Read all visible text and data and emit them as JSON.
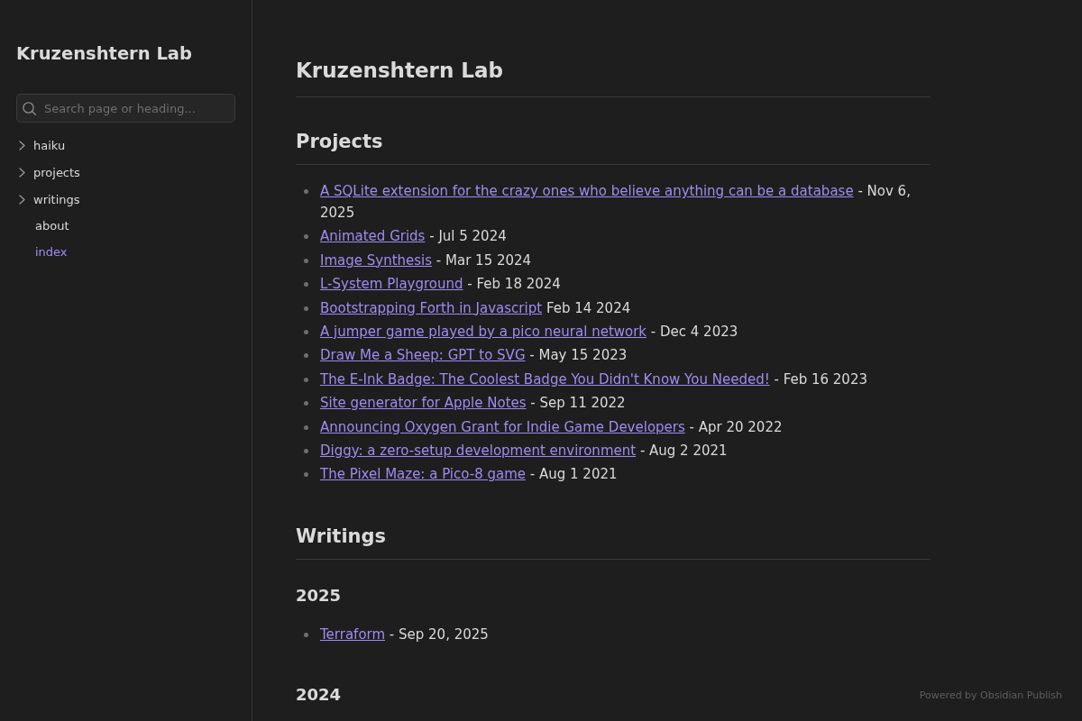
{
  "sidebar": {
    "title": "Kruzenshtern Lab",
    "search": {
      "placeholder": "Search page or heading..."
    },
    "items": [
      {
        "label": "haiku",
        "kind": "folder",
        "expanded": false,
        "selected": false
      },
      {
        "label": "projects",
        "kind": "folder",
        "expanded": false,
        "selected": false
      },
      {
        "label": "writings",
        "kind": "folder",
        "expanded": false,
        "selected": false
      },
      {
        "label": "about",
        "kind": "file",
        "selected": false
      },
      {
        "label": "index",
        "kind": "file",
        "selected": true
      }
    ]
  },
  "page": {
    "title": "Kruzenshtern Lab",
    "sections": [
      {
        "heading": "Projects",
        "entries": [
          {
            "link": "A SQLite extension for the crazy ones who believe anything can be a database",
            "date": "- Nov 6, 2025"
          },
          {
            "link": "Animated Grids",
            "date": "- Jul 5 2024"
          },
          {
            "link": "Image Synthesis",
            "date": "- Mar 15 2024"
          },
          {
            "link": "L-System Playground",
            "date": "- Feb 18 2024"
          },
          {
            "link": "Bootstrapping Forth in Javascript",
            "date": "Feb 14 2024"
          },
          {
            "link": "A jumper game played by a pico neural network",
            "date": "- Dec 4 2023"
          },
          {
            "link": "Draw Me a Sheep: GPT to SVG",
            "date": "- May 15 2023"
          },
          {
            "link": "The E-Ink Badge: The Coolest Badge You Didn't Know You Needed!",
            "date": "- Feb 16 2023"
          },
          {
            "link": "Site generator for Apple Notes",
            "date": "- Sep 11 2022"
          },
          {
            "link": "Announcing Oxygen Grant for Indie Game Developers",
            "date": "- Apr 20 2022"
          },
          {
            "link": "Diggy: a zero-setup development environment",
            "date": "- Aug 2 2021"
          },
          {
            "link": "The Pixel Maze: a Pico-8 game",
            "date": "- Aug 1 2021"
          }
        ]
      },
      {
        "heading": "Writings",
        "groups": [
          {
            "year": "2025",
            "entries": [
              {
                "link": "Terraform",
                "date": "- Sep 20, 2025"
              }
            ]
          },
          {
            "year": "2024"
          }
        ]
      }
    ]
  },
  "footer": "Powered by Obsidian Publish"
}
